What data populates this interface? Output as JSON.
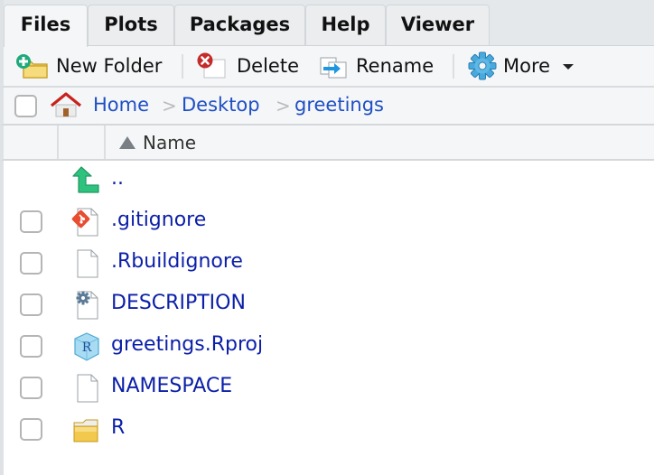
{
  "tabs": [
    {
      "label": "Files",
      "active": true
    },
    {
      "label": "Plots",
      "active": false
    },
    {
      "label": "Packages",
      "active": false
    },
    {
      "label": "Help",
      "active": false
    },
    {
      "label": "Viewer",
      "active": false
    }
  ],
  "toolbar": {
    "new_folder": {
      "label": "New Folder",
      "icon": "new-folder-icon"
    },
    "delete": {
      "label": "Delete",
      "icon": "delete-icon"
    },
    "rename": {
      "label": "Rename",
      "icon": "rename-icon"
    },
    "more": {
      "label": "More",
      "icon": "gear-icon"
    }
  },
  "breadcrumb": [
    {
      "label": "Home",
      "icon": "home-icon"
    },
    {
      "label": "Desktop"
    },
    {
      "label": "greetings"
    }
  ],
  "breadcrumb_separator": ">",
  "columns": {
    "name": {
      "label": "Name",
      "sort": "ascending"
    }
  },
  "files": [
    {
      "name": "..",
      "icon": "parent-directory-icon",
      "checkbox": false
    },
    {
      "name": ".gitignore",
      "icon": "git-file-icon",
      "checkbox": true
    },
    {
      "name": ".Rbuildignore",
      "icon": "file-icon",
      "checkbox": true
    },
    {
      "name": "DESCRIPTION",
      "icon": "settings-file-icon",
      "checkbox": true
    },
    {
      "name": "greetings.Rproj",
      "icon": "rproject-icon",
      "checkbox": true
    },
    {
      "name": "NAMESPACE",
      "icon": "file-icon",
      "checkbox": true
    },
    {
      "name": "R",
      "icon": "folder-icon",
      "checkbox": true
    }
  ],
  "colors": {
    "link": "#0b1fa8",
    "breadcrumb_link": "#1f4fc4",
    "panel_bg": "#f4f6f8"
  }
}
